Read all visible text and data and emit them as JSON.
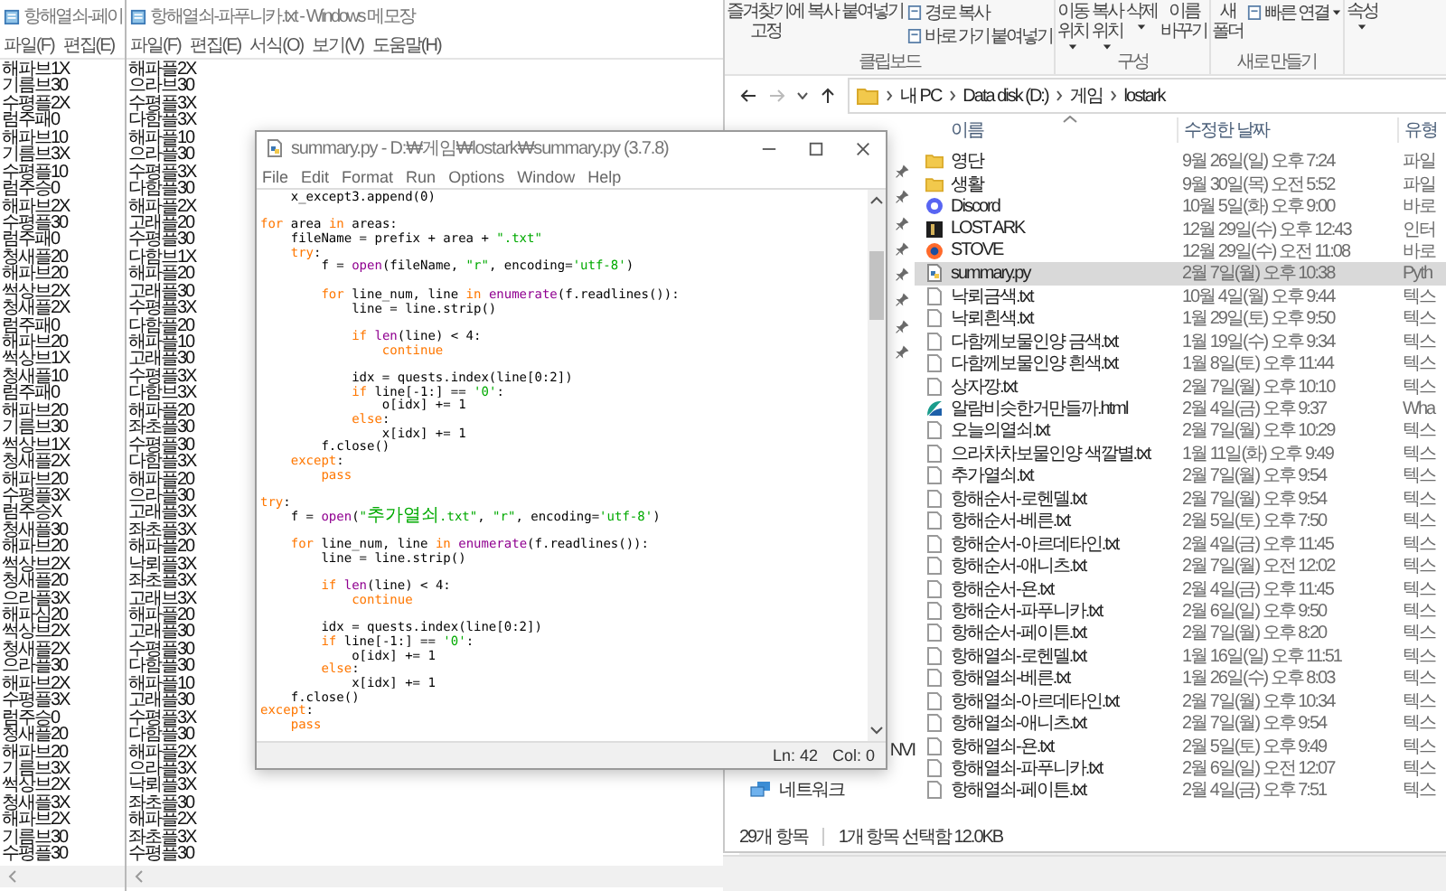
{
  "notepad_left": {
    "title": "항해열쇠-페이",
    "menu": [
      "파일(F)",
      "편집(E)"
    ],
    "lines": [
      "해파브1X",
      "기름브30",
      "수평플2X",
      "럼주패0",
      "해파브10",
      "기름브3X",
      "수평플10",
      "럼주승0",
      "해파브2X",
      "수평플30",
      "럼주패0",
      "청새플20",
      "해파브20",
      "썩상브2X",
      "청새플2X",
      "럼주패0",
      "해파브20",
      "썩상브1X",
      "청새플10",
      "럼주패0",
      "해파브20",
      "기름브30",
      "썩상브1X",
      "청새플2X",
      "해파브20",
      "수평플3X",
      "럼주승X",
      "청새플30",
      "해파브20",
      "썩상브2X",
      "청새플20",
      "으라플3X",
      "해파심20",
      "썩상브2X",
      "청새플2X",
      "으라플30",
      "해파브2X",
      "수평플3X",
      "럼주승0",
      "청새플20",
      "해파브20",
      "기름브3X",
      "썩상브2X",
      "청새플3X",
      "해파브2X",
      "기름브30",
      "수평플30"
    ]
  },
  "notepad_middle": {
    "title": "항해열쇠-파푸니카.txt - Windows 메모장",
    "menu": [
      "파일(F)",
      "편집(E)",
      "서식(O)",
      "보기(V)",
      "도움말(H)"
    ],
    "lines": [
      "해파플2X",
      "으라브30",
      "수평플3X",
      "다함플3X",
      "해파플10",
      "으라플30",
      "수평플3X",
      "다함플30",
      "해파플2X",
      "고래플20",
      "수평플30",
      "다함브1X",
      "해파플20",
      "고래플30",
      "수평플3X",
      "다함플20",
      "해파플10",
      "고래플30",
      "수평플3X",
      "다함브3X",
      "해파플20",
      "좌초플30",
      "수평플30",
      "다함플3X",
      "해파플20",
      "으라플30",
      "고래플3X",
      "좌초플3X",
      "해파플20",
      "낙뢰플3X",
      "좌초플3X",
      "고래브3X",
      "해파플20",
      "고래플30",
      "수평플30",
      "다함플30",
      "해파플10",
      "고래플30",
      "수평플3X",
      "다함플30",
      "해파플2X",
      "으라플3X",
      "낙뢰플3X",
      "좌초플30",
      "해파플2X",
      "좌초플3X",
      "수평플30"
    ]
  },
  "explorer": {
    "ribbon": [
      {
        "label": "클립보드",
        "buttons": [
          {
            "label": "즐겨찾기에 고정",
            "kind": "large",
            "dropdown": false
          },
          {
            "label": "복사",
            "kind": "large",
            "dropdown": false
          },
          {
            "label": "붙여넣기",
            "kind": "large",
            "dropdown": false
          },
          {
            "label": "경로 복사",
            "kind": "small",
            "dropdown": false
          },
          {
            "label": "바로 가기 붙여넣기",
            "kind": "small",
            "dropdown": false
          }
        ]
      },
      {
        "label": "구성",
        "buttons": [
          {
            "label": "이동 위치",
            "kind": "large",
            "dropdown": true
          },
          {
            "label": "복사 위치",
            "kind": "large",
            "dropdown": true
          },
          {
            "label": "삭제",
            "kind": "large",
            "dropdown": true
          },
          {
            "label": "이름 바꾸기",
            "kind": "large",
            "dropdown": false
          }
        ]
      },
      {
        "label": "새로 만들기",
        "buttons": [
          {
            "label": "새 폴더",
            "kind": "large",
            "dropdown": false
          },
          {
            "label": "빠른 연결",
            "kind": "small",
            "dropdown": true
          }
        ]
      },
      {
        "buttons": [
          {
            "label": "속성",
            "kind": "large",
            "dropdown": true
          }
        ]
      }
    ],
    "address": [
      "내 PC",
      "Data disk (D:)",
      "게임",
      "lostark"
    ],
    "nav": {
      "cut_item": "NVI",
      "network": "네트워크"
    },
    "columns": [
      "이름",
      "수정한 날짜",
      "유형"
    ],
    "files": [
      {
        "name": "영단",
        "modified": "9월 26일(일) 오후 7:24",
        "type": "파일",
        "kind": "folder",
        "selected": false
      },
      {
        "name": "생활",
        "modified": "9월 30일(목) 오전 5:52",
        "type": "파일",
        "kind": "folder",
        "selected": false
      },
      {
        "name": "Discord",
        "modified": "10월 5일(화) 오후 9:00",
        "type": "바로",
        "kind": "shortcut",
        "selected": false
      },
      {
        "name": "LOST ARK",
        "modified": "12월 29일(수) 오후 12:43",
        "type": "인터",
        "kind": "program",
        "selected": false
      },
      {
        "name": "STOVE",
        "modified": "12월 29일(수) 오전 11:08",
        "type": "바로",
        "kind": "launcher",
        "selected": false
      },
      {
        "name": "summary.py",
        "modified": "2월 7일(월) 오후 10:38",
        "type": "Pyth",
        "kind": "script",
        "selected": true
      },
      {
        "name": "낙뢰금색.txt",
        "modified": "10월 4일(월) 오후 9:44",
        "type": "텍스",
        "kind": "text",
        "selected": false
      },
      {
        "name": "낙뢰흰색.txt",
        "modified": "1월 29일(토) 오후 9:50",
        "type": "텍스",
        "kind": "text",
        "selected": false
      },
      {
        "name": "다함께보물인양 금색.txt",
        "modified": "1월 19일(수) 오후 9:34",
        "type": "텍스",
        "kind": "text",
        "selected": false
      },
      {
        "name": "다함께보물인양 흰색.txt",
        "modified": "1월 8일(토) 오후 11:44",
        "type": "텍스",
        "kind": "text",
        "selected": false
      },
      {
        "name": "상자깡.txt",
        "modified": "2월 7일(월) 오후 10:10",
        "type": "텍스",
        "kind": "text",
        "selected": false
      },
      {
        "name": "알람비슷한거만들까.html",
        "modified": "2월 4일(금) 오후 9:37",
        "type": "Wha",
        "kind": "webpage",
        "selected": false
      },
      {
        "name": "오늘의열쇠.txt",
        "modified": "2월 7일(월) 오후 10:29",
        "type": "텍스",
        "kind": "text",
        "selected": false
      },
      {
        "name": "으라차차보물인양 색깔별.txt",
        "modified": "1월 11일(화) 오후 9:49",
        "type": "텍스",
        "kind": "text",
        "selected": false
      },
      {
        "name": "추가열쇠.txt",
        "modified": "2월 7일(월) 오후 9:54",
        "type": "텍스",
        "kind": "text",
        "selected": false
      },
      {
        "name": "항해순서-로헨델.txt",
        "modified": "2월 7일(월) 오후 9:54",
        "type": "텍스",
        "kind": "text",
        "selected": false
      },
      {
        "name": "항해순서-베른.txt",
        "modified": "2월 5일(토) 오후 7:50",
        "type": "텍스",
        "kind": "text",
        "selected": false
      },
      {
        "name": "항해순서-아르데타인.txt",
        "modified": "2월 4일(금) 오후 11:45",
        "type": "텍스",
        "kind": "text",
        "selected": false
      },
      {
        "name": "항해순서-애니츠.txt",
        "modified": "2월 7일(월) 오전 12:02",
        "type": "텍스",
        "kind": "text",
        "selected": false
      },
      {
        "name": "항해순서-욘.txt",
        "modified": "2월 4일(금) 오후 11:45",
        "type": "텍스",
        "kind": "text",
        "selected": false
      },
      {
        "name": "항해순서-파푸니카.txt",
        "modified": "2월 6일(일) 오후 9:50",
        "type": "텍스",
        "kind": "text",
        "selected": false
      },
      {
        "name": "항해순서-페이튼.txt",
        "modified": "2월 7일(월) 오후 8:20",
        "type": "텍스",
        "kind": "text",
        "selected": false
      },
      {
        "name": "항해열쇠-로헨델.txt",
        "modified": "1월 16일(일) 오후 11:51",
        "type": "텍스",
        "kind": "text",
        "selected": false
      },
      {
        "name": "항해열쇠-베른.txt",
        "modified": "1월 26일(수) 오후 8:03",
        "type": "텍스",
        "kind": "text",
        "selected": false
      },
      {
        "name": "항해열쇠-아르데타인.txt",
        "modified": "2월 7일(월) 오후 10:34",
        "type": "텍스",
        "kind": "text",
        "selected": false
      },
      {
        "name": "항해열쇠-애니츠.txt",
        "modified": "2월 7일(월) 오후 9:54",
        "type": "텍스",
        "kind": "text",
        "selected": false
      },
      {
        "name": "항해열쇠-욘.txt",
        "modified": "2월 5일(토) 오후 9:49",
        "type": "텍스",
        "kind": "text",
        "selected": false
      },
      {
        "name": "항해열쇠-파푸니카.txt",
        "modified": "2월 6일(일) 오전 12:07",
        "type": "텍스",
        "kind": "text",
        "selected": false
      },
      {
        "name": "항해열쇠-페이튼.txt",
        "modified": "2월 4일(금) 오후 7:51",
        "type": "텍스",
        "kind": "text",
        "selected": false
      }
    ],
    "status_bar": {
      "item_count": "29개 항목",
      "selection": "1개 항목 선택함 12.0KB"
    }
  },
  "idle": {
    "title": "summary.py - D:₩게임₩lostark₩summary.py (3.7.8)",
    "menu": [
      "File",
      "Edit",
      "Format",
      "Run",
      "Options",
      "Window",
      "Help"
    ],
    "code": [
      {
        "kind": "code",
        "tokens": [
          {
            "kind": "plain",
            "text": "    x_except3.append(0)"
          }
        ]
      },
      {
        "kind": "blank"
      },
      {
        "kind": "code",
        "tokens": [
          {
            "kind": "keyword",
            "text": "for"
          },
          {
            "kind": "plain",
            "text": " area "
          },
          {
            "kind": "keyword",
            "text": "in"
          },
          {
            "kind": "plain",
            "text": " areas:"
          }
        ]
      },
      {
        "kind": "code",
        "tokens": [
          {
            "kind": "plain",
            "text": "    fileName = prefix + area + "
          },
          {
            "kind": "string",
            "text": "\".txt\""
          }
        ]
      },
      {
        "kind": "code",
        "tokens": [
          {
            "kind": "keyword",
            "text": "    try"
          },
          {
            "kind": "plain",
            "text": ":"
          }
        ]
      },
      {
        "kind": "code",
        "tokens": [
          {
            "kind": "plain",
            "text": "        f = "
          },
          {
            "kind": "builtin",
            "text": "open"
          },
          {
            "kind": "plain",
            "text": "(fileName, "
          },
          {
            "kind": "string",
            "text": "\"r\""
          },
          {
            "kind": "plain",
            "text": ", encoding="
          },
          {
            "kind": "string",
            "text": "'utf-8'"
          },
          {
            "kind": "plain",
            "text": ")"
          }
        ]
      },
      {
        "kind": "blank"
      },
      {
        "kind": "code",
        "tokens": [
          {
            "kind": "keyword",
            "text": "        for"
          },
          {
            "kind": "plain",
            "text": " line_num, line "
          },
          {
            "kind": "keyword",
            "text": "in"
          },
          {
            "kind": "builtin",
            "text": " enumerate"
          },
          {
            "kind": "plain",
            "text": "(f.readlines()):"
          }
        ]
      },
      {
        "kind": "code",
        "tokens": [
          {
            "kind": "plain",
            "text": "            line = line.strip()"
          }
        ]
      },
      {
        "kind": "blank"
      },
      {
        "kind": "code",
        "tokens": [
          {
            "kind": "keyword",
            "text": "            if"
          },
          {
            "kind": "builtin",
            "text": " len"
          },
          {
            "kind": "plain",
            "text": "(line) < 4:"
          }
        ]
      },
      {
        "kind": "code",
        "tokens": [
          {
            "kind": "keyword",
            "text": "                continue"
          }
        ]
      },
      {
        "kind": "blank"
      },
      {
        "kind": "code",
        "tokens": [
          {
            "kind": "plain",
            "text": "            idx = quests.index(line[0:2])"
          }
        ]
      },
      {
        "kind": "code",
        "tokens": [
          {
            "kind": "keyword",
            "text": "            if"
          },
          {
            "kind": "plain",
            "text": " line[-1:] == "
          },
          {
            "kind": "string",
            "text": "'0'"
          },
          {
            "kind": "plain",
            "text": ":"
          }
        ]
      },
      {
        "kind": "code",
        "tokens": [
          {
            "kind": "plain",
            "text": "                o[idx] += 1"
          }
        ]
      },
      {
        "kind": "code",
        "tokens": [
          {
            "kind": "keyword",
            "text": "            else"
          },
          {
            "kind": "plain",
            "text": ":"
          }
        ]
      },
      {
        "kind": "code",
        "tokens": [
          {
            "kind": "plain",
            "text": "                x[idx] += 1"
          }
        ]
      },
      {
        "kind": "code",
        "tokens": [
          {
            "kind": "plain",
            "text": "        f.close()"
          }
        ]
      },
      {
        "kind": "code",
        "tokens": [
          {
            "kind": "keyword",
            "text": "    except"
          },
          {
            "kind": "plain",
            "text": ":"
          }
        ]
      },
      {
        "kind": "code",
        "tokens": [
          {
            "kind": "keyword",
            "text": "        pass"
          }
        ]
      },
      {
        "kind": "blank"
      },
      {
        "kind": "code",
        "tokens": [
          {
            "kind": "keyword",
            "text": "try"
          },
          {
            "kind": "plain",
            "text": ":"
          }
        ]
      },
      {
        "kind": "code",
        "tokens": [
          {
            "kind": "plain",
            "text": "    f = "
          },
          {
            "kind": "builtin",
            "text": "open"
          },
          {
            "kind": "plain",
            "text": "("
          },
          {
            "kind": "string",
            "text": "\"추가열쇠.txt\""
          },
          {
            "kind": "plain",
            "text": ", "
          },
          {
            "kind": "string",
            "text": "\"r\""
          },
          {
            "kind": "plain",
            "text": ", encoding="
          },
          {
            "kind": "string",
            "text": "'utf-8'"
          },
          {
            "kind": "plain",
            "text": ")"
          }
        ]
      },
      {
        "kind": "blank"
      },
      {
        "kind": "code",
        "tokens": [
          {
            "kind": "keyword",
            "text": "    for"
          },
          {
            "kind": "plain",
            "text": " line_num, line "
          },
          {
            "kind": "keyword",
            "text": "in"
          },
          {
            "kind": "builtin",
            "text": " enumerate"
          },
          {
            "kind": "plain",
            "text": "(f.readlines()):"
          }
        ]
      },
      {
        "kind": "code",
        "tokens": [
          {
            "kind": "plain",
            "text": "        line = line.strip()"
          }
        ]
      },
      {
        "kind": "blank"
      },
      {
        "kind": "code",
        "tokens": [
          {
            "kind": "keyword",
            "text": "        if"
          },
          {
            "kind": "builtin",
            "text": " len"
          },
          {
            "kind": "plain",
            "text": "(line) < 4:"
          }
        ]
      },
      {
        "kind": "code",
        "tokens": [
          {
            "kind": "keyword",
            "text": "            continue"
          }
        ]
      },
      {
        "kind": "blank"
      },
      {
        "kind": "code",
        "tokens": [
          {
            "kind": "plain",
            "text": "        idx = quests.index(line[0:2])"
          }
        ]
      },
      {
        "kind": "code",
        "tokens": [
          {
            "kind": "keyword",
            "text": "        if"
          },
          {
            "kind": "plain",
            "text": " line[-1:] == "
          },
          {
            "kind": "string",
            "text": "'0'"
          },
          {
            "kind": "plain",
            "text": ":"
          }
        ]
      },
      {
        "kind": "code",
        "tokens": [
          {
            "kind": "plain",
            "text": "            o[idx] += 1"
          }
        ]
      },
      {
        "kind": "code",
        "tokens": [
          {
            "kind": "keyword",
            "text": "        else"
          },
          {
            "kind": "plain",
            "text": ":"
          }
        ]
      },
      {
        "kind": "code",
        "tokens": [
          {
            "kind": "plain",
            "text": "            x[idx] += 1"
          }
        ]
      },
      {
        "kind": "code",
        "tokens": [
          {
            "kind": "plain",
            "text": "    f.close()"
          }
        ]
      },
      {
        "kind": "code",
        "tokens": [
          {
            "kind": "keyword",
            "text": "except"
          },
          {
            "kind": "plain",
            "text": ":"
          }
        ]
      },
      {
        "kind": "code",
        "tokens": [
          {
            "kind": "keyword",
            "text": "    pass"
          }
        ]
      }
    ],
    "status": {
      "line": "Ln: 42",
      "column": "Col: 0"
    }
  }
}
